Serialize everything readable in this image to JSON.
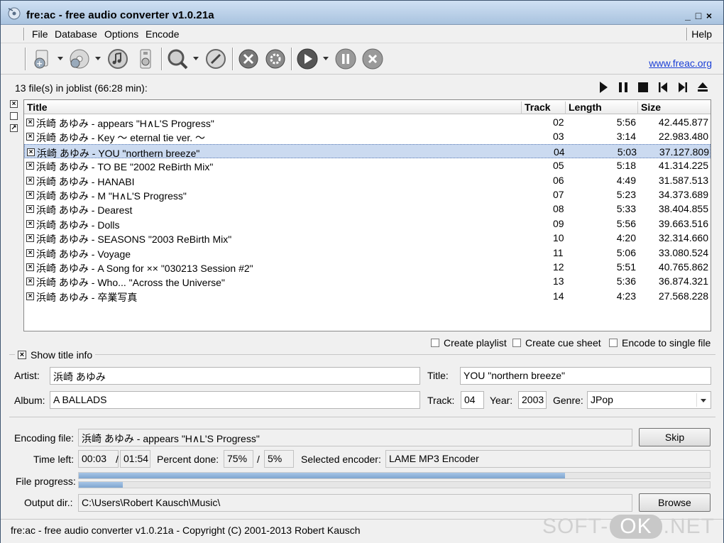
{
  "window": {
    "title": "fre:ac - free audio converter v1.0.21a"
  },
  "menu": {
    "items": [
      "File",
      "Database",
      "Options",
      "Encode"
    ],
    "help": "Help"
  },
  "toolbar": {
    "icons": [
      "add-files-icon",
      "add-cd-icon",
      "cddb-query-icon",
      "cddb-submit-icon",
      "search-icon",
      "cd-info-icon",
      "configure-general-icon",
      "configure-encoder-icon",
      "start-encoding-icon",
      "pause-encoding-icon",
      "stop-encoding-icon"
    ],
    "link": "www.freac.org"
  },
  "joblist": {
    "summary": "13 file(s) in joblist (66:28 min):",
    "columns": {
      "title": "Title",
      "track": "Track",
      "length": "Length",
      "size": "Size"
    },
    "rows": [
      {
        "title": "浜崎 あゆみ - appears \"H∧L'S Progress\"",
        "track": "02",
        "length": "5:56",
        "size": "42.445.877",
        "checked": true
      },
      {
        "title": "浜崎 あゆみ - Key ～ eternal tie ver. ～",
        "track": "03",
        "length": "3:14",
        "size": "22.983.480",
        "checked": true
      },
      {
        "title": "浜崎 あゆみ - YOU \"northern breeze\"",
        "track": "04",
        "length": "5:03",
        "size": "37.127.809",
        "checked": true,
        "selected": true
      },
      {
        "title": "浜崎 あゆみ - TO BE \"2002 ReBirth Mix\"",
        "track": "05",
        "length": "5:18",
        "size": "41.314.225",
        "checked": true
      },
      {
        "title": "浜崎 あゆみ - HANABI",
        "track": "06",
        "length": "4:49",
        "size": "31.587.513",
        "checked": true
      },
      {
        "title": "浜崎 あゆみ - M \"H∧L'S Progress\"",
        "track": "07",
        "length": "5:23",
        "size": "34.373.689",
        "checked": true
      },
      {
        "title": "浜崎 あゆみ - Dearest",
        "track": "08",
        "length": "5:33",
        "size": "38.404.855",
        "checked": true
      },
      {
        "title": "浜崎 あゆみ - Dolls",
        "track": "09",
        "length": "5:56",
        "size": "39.663.516",
        "checked": true
      },
      {
        "title": "浜崎 あゆみ - SEASONS \"2003 ReBirth Mix\"",
        "track": "10",
        "length": "4:20",
        "size": "32.314.660",
        "checked": true
      },
      {
        "title": "浜崎 あゆみ - Voyage",
        "track": "11",
        "length": "5:06",
        "size": "33.080.524",
        "checked": true
      },
      {
        "title": "浜崎 あゆみ - A Song for ×× \"030213 Session #2\"",
        "track": "12",
        "length": "5:51",
        "size": "40.765.862",
        "checked": true
      },
      {
        "title": "浜崎 あゆみ - Who... \"Across the Universe\"",
        "track": "13",
        "length": "5:36",
        "size": "36.874.321",
        "checked": true
      },
      {
        "title": "浜崎 あゆみ - 卒業写真",
        "track": "14",
        "length": "4:23",
        "size": "27.568.228",
        "checked": true
      }
    ]
  },
  "options": {
    "create_playlist": "Create playlist",
    "create_cue_sheet": "Create cue sheet",
    "encode_single": "Encode to single file"
  },
  "titleinfo": {
    "toggle_label": "Show title info",
    "artist_label": "Artist:",
    "artist": "浜崎 あゆみ",
    "title_label": "Title:",
    "title": "YOU \"northern breeze\"",
    "album_label": "Album:",
    "album": "A BALLADS",
    "track_label": "Track:",
    "track": "04",
    "year_label": "Year:",
    "year": "2003",
    "genre_label": "Genre:",
    "genre": "JPop"
  },
  "encoding": {
    "file_label": "Encoding file:",
    "file": "浜崎 あゆみ - appears \"H∧L'S Progress\"",
    "skip": "Skip",
    "time_left_label": "Time left:",
    "time_left": "00:03",
    "time_total": "01:54",
    "percent_label": "Percent done:",
    "percent_file": "75%",
    "slash": "/",
    "percent_total": "5%",
    "encoder_label": "Selected encoder:",
    "encoder": "LAME MP3 Encoder",
    "file_progress_label": "File progress:",
    "file_progress": 0.77,
    "total_progress": 0.07,
    "output_label": "Output dir.:",
    "output": "C:\\Users\\Robert Kausch\\Music\\",
    "browse": "Browse"
  },
  "status": {
    "text": "fre:ac - free audio converter v1.0.21a - Copyright (C) 2001-2013 Robert Kausch"
  },
  "watermark": {
    "left": "SOFT-",
    "ok": "OK",
    "right": ".NET"
  }
}
